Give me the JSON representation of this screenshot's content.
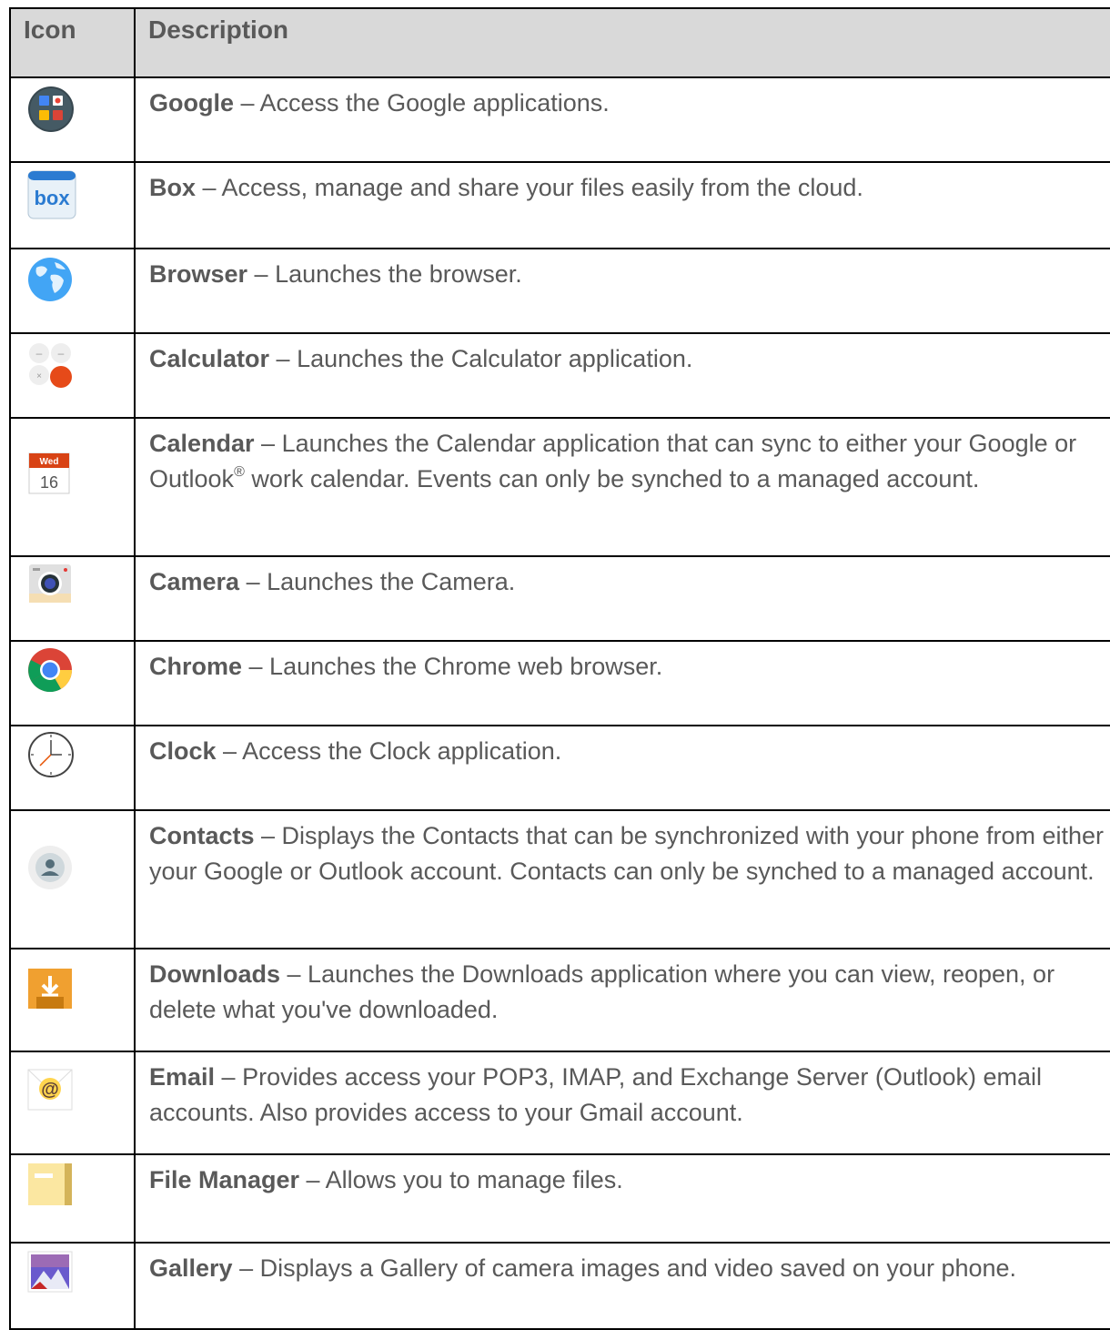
{
  "header": {
    "icon": "Icon",
    "description": "Description"
  },
  "rows": [
    {
      "icon": "google-folder-icon",
      "name": "Google",
      "sep": " – ",
      "text": "Access the Google applications."
    },
    {
      "icon": "box-icon",
      "name": "Box",
      "sep": " – ",
      "text": "Access, manage and share your files easily from the cloud."
    },
    {
      "icon": "browser-globe-icon",
      "name": "Browser",
      "sep": " – ",
      "text": "Launches the browser."
    },
    {
      "icon": "calculator-icon",
      "name": "Calculator",
      "sep": " – ",
      "text": "Launches the Calculator application."
    },
    {
      "icon": "calendar-icon",
      "name": "Calendar",
      "sep": " – ",
      "text_a": "Launches the Calendar application that can sync to either your Google or Outlook",
      "sup": "®",
      "text_b": " work calendar. Events can only be synched to a managed account.",
      "icon_day": "Wed",
      "icon_date": "16"
    },
    {
      "icon": "camera-icon",
      "name": "Camera",
      "sep": " – ",
      "text": "Launches the Camera."
    },
    {
      "icon": "chrome-icon",
      "name": "Chrome",
      "sep": " – ",
      "text": "Launches the Chrome web browser."
    },
    {
      "icon": "clock-icon",
      "name": "Clock",
      "sep": " – ",
      "text": "Access the Clock application."
    },
    {
      "icon": "contacts-icon",
      "name": "Contacts",
      "sep": " – ",
      "text": "Displays the Contacts that can be synchronized with your phone from either your Google or Outlook account. Contacts can only be synched to a managed account."
    },
    {
      "icon": "downloads-icon",
      "name": "Downloads",
      "sep": " – ",
      "text": "Launches the Downloads application where you can view, reopen, or delete what you've downloaded."
    },
    {
      "icon": "email-icon",
      "name": "Email",
      "sep": " – ",
      "text": "Provides access your POP3, IMAP, and Exchange Server (Outlook) email accounts. Also provides access to your Gmail account."
    },
    {
      "icon": "file-manager-icon",
      "name": "File Manager",
      "sep": " – ",
      "text": "Allows you to manage files."
    },
    {
      "icon": "gallery-icon",
      "name": "Gallery",
      "sep": " – ",
      "text": "Displays a Gallery of camera images and video saved on your phone."
    }
  ]
}
